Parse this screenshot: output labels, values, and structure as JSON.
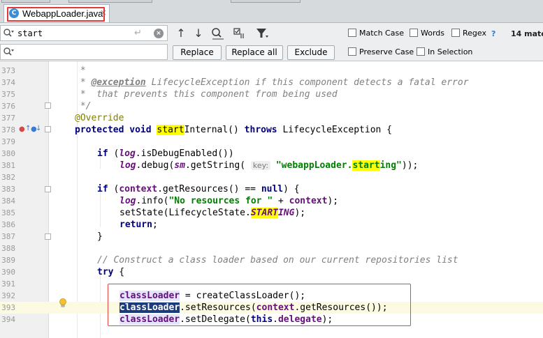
{
  "tab": {
    "icon": "C",
    "filename": "WebappLoader.java",
    "close": "×"
  },
  "find": {
    "search_value": "start",
    "replace_value": "",
    "enter_glyph": "↵",
    "clear_glyph": "×"
  },
  "toolbar": {
    "prev_glyph": "↑",
    "next_glyph": "↓",
    "filter_glyph": "▼"
  },
  "buttons": {
    "replace": "Replace",
    "replace_all": "Replace all",
    "exclude": "Exclude"
  },
  "options": {
    "match_case": "Match Case",
    "words": "Words",
    "regex": "Regex",
    "help": "?",
    "preserve_case": "Preserve Case",
    "in_selection": "In Selection",
    "match_count": "14 matc"
  },
  "colors": {
    "keyword": "#000080",
    "field": "#660e7a",
    "string": "#008000",
    "comment": "#808080",
    "annotation": "#808000",
    "search_highlight": "#ffff00",
    "selection": "#1b3b7a",
    "red_outline": "#e64545"
  },
  "editor": {
    "line_numbers": [
      "373",
      "374",
      "375",
      "376",
      "377",
      "378",
      "379",
      "380",
      "381",
      "382",
      "383",
      "384",
      "385",
      "386",
      "387",
      "388",
      "389",
      "390",
      "391",
      "392",
      "393",
      "394"
    ],
    "current_line": "393",
    "lines": {
      "l373": {
        "comment": " *"
      },
      "l374": {
        "tag": "@exception",
        "rest": " LifecycleException if this component detects a fatal error"
      },
      "l375": {
        "comment": " *  that prevents this component from being used"
      },
      "l376": {
        "comment": " */"
      },
      "l377": {
        "annotation": "@Override"
      },
      "l378": {
        "kw1": "protected",
        "kw2": "void",
        "match": "start",
        "name_rest": "Internal()",
        "kw3": "throws",
        "rest": "LifecycleException {"
      },
      "l380": {
        "kw": "if",
        "open": "(",
        "field": "log",
        "rest": ".isDebugEnabled())"
      },
      "l381": {
        "field1": "log",
        "mid1": ".debug(",
        "field2": "sm",
        "mid2": ".getString(",
        "hint": "key:",
        "str1": "\"webappLoader.",
        "match": "start",
        "str2": "ing\"",
        "end": "));"
      },
      "l383": {
        "kw": "if",
        "open": "(",
        "field": "context",
        "mid": ".getResources() == ",
        "kw2": "null",
        "end": ") {"
      },
      "l384": {
        "field1": "log",
        "mid1": ".info(",
        "str": "\"No resources for \"",
        "mid2": " + ",
        "field2": "context",
        "end": ");"
      },
      "l385": {
        "pre": "setState(LifecycleState.",
        "match": "START",
        "field_rest": "ING",
        "end": ");"
      },
      "l386": {
        "kw": "return",
        "end": ";"
      },
      "l387": {
        "code": "}"
      },
      "l389": {
        "comment": "// Construct a class loader based on our current repositories list"
      },
      "l390": {
        "kw": "try",
        "end": " {"
      },
      "l392": {
        "field": "classLoader",
        "rest": " = createClassLoader();"
      },
      "l393": {
        "sel": "classLoader",
        "mid": ".setResources(",
        "field": "context",
        "end": ".getResources());"
      },
      "l394": {
        "field": "classLoader",
        "mid": ".setDelegate(",
        "kw": "this",
        "dot": ".",
        "field2": "delegate",
        "end": ");"
      }
    }
  }
}
